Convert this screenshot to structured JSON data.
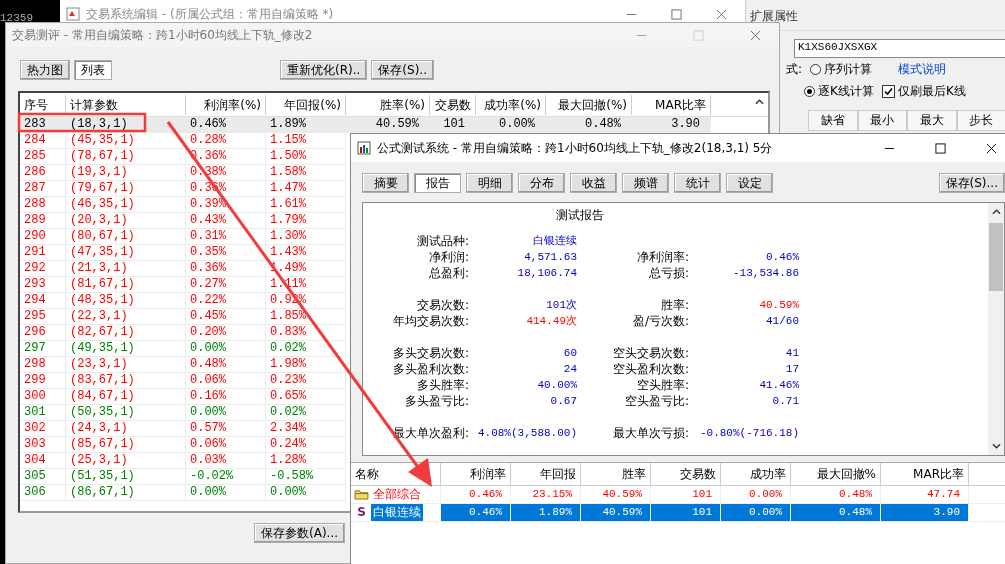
{
  "background": {
    "ticker": "12359"
  },
  "editor_window": {
    "title": "交易系统编辑 - (所属公式组：常用自编策略 *)"
  },
  "properties_panel": {
    "title": "扩展属性",
    "code_field": "K1XS60JXSXGX",
    "mode_label": "式:",
    "modes": [
      {
        "label": "序列计算",
        "selected": false
      },
      {
        "label": "逐K线计算",
        "selected": true
      }
    ],
    "help_link": "模式说明",
    "refresh_last_only": {
      "label": "仅刷最后K线",
      "checked": true
    },
    "param_columns": [
      "缺省",
      "最小",
      "最大",
      "步长"
    ]
  },
  "evaluation_window": {
    "title": "交易测评 - 常用自编策略：跨1小时60均线上下轨_修改2",
    "view_tabs": [
      {
        "label": "热力图",
        "selected": false
      },
      {
        "label": "列表",
        "selected": true
      }
    ],
    "buttons": [
      "重新优化(R)..",
      "保存(S).."
    ],
    "table": {
      "columns": [
        "序号",
        "计算参数",
        "利润率(%)",
        "年回报(%)",
        "胜率(%)",
        "交易数",
        "成功率(%)",
        "最大回撤(%)",
        "MAR比率"
      ],
      "rows": [
        {
          "cells": [
            "283",
            "(18,3,1)",
            "0.46%",
            "1.89%",
            "40.59%",
            "101",
            "0.00%",
            "0.48%",
            "3.90"
          ],
          "color": "#000000",
          "selected": true
        },
        {
          "cells": [
            "284",
            "(45,35,1)",
            "0.28%",
            "1.15%"
          ],
          "color": "#ff0000",
          "selected": false
        },
        {
          "cells": [
            "285",
            "(78,67,1)",
            "0.36%",
            "1.50%"
          ],
          "color": "#ff0000",
          "selected": false
        },
        {
          "cells": [
            "286",
            "(19,3,1)",
            "0.38%",
            "1.58%"
          ],
          "color": "#ff0000",
          "selected": false
        },
        {
          "cells": [
            "287",
            "(79,67,1)",
            "0.36%",
            "1.47%"
          ],
          "color": "#ff0000",
          "selected": false
        },
        {
          "cells": [
            "288",
            "(46,35,1)",
            "0.39%",
            "1.61%"
          ],
          "color": "#ff0000",
          "selected": false
        },
        {
          "cells": [
            "289",
            "(20,3,1)",
            "0.43%",
            "1.79%"
          ],
          "color": "#ff0000",
          "selected": false
        },
        {
          "cells": [
            "290",
            "(80,67,1)",
            "0.31%",
            "1.30%"
          ],
          "color": "#ff0000",
          "selected": false
        },
        {
          "cells": [
            "291",
            "(47,35,1)",
            "0.35%",
            "1.43%"
          ],
          "color": "#ff0000",
          "selected": false
        },
        {
          "cells": [
            "292",
            "(21,3,1)",
            "0.36%",
            "1.49%"
          ],
          "color": "#ff0000",
          "selected": false
        },
        {
          "cells": [
            "293",
            "(81,67,1)",
            "0.27%",
            "1.11%"
          ],
          "color": "#ff0000",
          "selected": false
        },
        {
          "cells": [
            "294",
            "(48,35,1)",
            "0.22%",
            "0.92%"
          ],
          "color": "#ff0000",
          "selected": false
        },
        {
          "cells": [
            "295",
            "(22,3,1)",
            "0.45%",
            "1.85%"
          ],
          "color": "#ff0000",
          "selected": false
        },
        {
          "cells": [
            "296",
            "(82,67,1)",
            "0.20%",
            "0.83%"
          ],
          "color": "#ff0000",
          "selected": false
        },
        {
          "cells": [
            "297",
            "(49,35,1)",
            "0.00%",
            "0.02%"
          ],
          "color": "#008000",
          "selected": false
        },
        {
          "cells": [
            "298",
            "(23,3,1)",
            "0.48%",
            "1.98%"
          ],
          "color": "#ff0000",
          "selected": false
        },
        {
          "cells": [
            "299",
            "(83,67,1)",
            "0.06%",
            "0.23%"
          ],
          "color": "#ff0000",
          "selected": false
        },
        {
          "cells": [
            "300",
            "(84,67,1)",
            "0.16%",
            "0.65%"
          ],
          "color": "#ff0000",
          "selected": false
        },
        {
          "cells": [
            "301",
            "(50,35,1)",
            "0.00%",
            "0.02%"
          ],
          "color": "#008000",
          "selected": false
        },
        {
          "cells": [
            "302",
            "(24,3,1)",
            "0.57%",
            "2.34%"
          ],
          "color": "#ff0000",
          "selected": false
        },
        {
          "cells": [
            "303",
            "(85,67,1)",
            "0.06%",
            "0.24%"
          ],
          "color": "#ff0000",
          "selected": false
        },
        {
          "cells": [
            "304",
            "(25,3,1)",
            "0.03%",
            "1.28%"
          ],
          "color": "#ff0000",
          "selected": false
        },
        {
          "cells": [
            "305",
            "(51,35,1)",
            "-0.02%",
            "-0.58%"
          ],
          "color": "#008000",
          "selected": false
        },
        {
          "cells": [
            "306",
            "(86,67,1)",
            "0.00%",
            "0.00%"
          ],
          "color": "#008000",
          "selected": false
        }
      ]
    },
    "save_params_button": "保存参数(A)..."
  },
  "test_window": {
    "title": "公式测试系统 - 常用自编策略：跨1小时60均线上下轨_修改2(18,3,1) 5分",
    "tabs": [
      {
        "label": "摘要",
        "selected": false
      },
      {
        "label": "报告",
        "selected": true
      },
      {
        "label": "明细",
        "selected": false
      },
      {
        "label": "分布",
        "selected": false
      },
      {
        "label": "收益",
        "selected": false
      },
      {
        "label": "频谱",
        "selected": false
      },
      {
        "label": "统计",
        "selected": false
      },
      {
        "label": "设定",
        "selected": false
      }
    ],
    "save_button": "保存(S)...",
    "report": {
      "title": "测试报告",
      "groups": [
        {
          "rows": [
            {
              "items": [
                {
                  "label": "测试品种:",
                  "value": "白银连续",
                  "alert": false
                }
              ]
            },
            {
              "items": [
                {
                  "label": "净利润:",
                  "value": "4,571.63",
                  "alert": false
                },
                {
                  "label": "净利润率:",
                  "value": "0.46%",
                  "alert": false
                }
              ]
            },
            {
              "items": [
                {
                  "label": "总盈利:",
                  "value": "18,106.74",
                  "alert": false
                },
                {
                  "label": "总亏损:",
                  "value": "-13,534.86",
                  "alert": false
                }
              ]
            }
          ]
        },
        {
          "rows": [
            {
              "items": [
                {
                  "label": "交易次数:",
                  "value": "101次",
                  "alert": false
                },
                {
                  "label": "胜率:",
                  "value": "40.59%",
                  "alert": true
                }
              ]
            },
            {
              "items": [
                {
                  "label": "年均交易次数:",
                  "value": "414.49次",
                  "alert": true
                },
                {
                  "label": "盈/亏次数:",
                  "value": "41/60",
                  "alert": false
                }
              ]
            }
          ]
        },
        {
          "rows": [
            {
              "items": [
                {
                  "label": "多头交易次数:",
                  "value": "60",
                  "alert": false
                },
                {
                  "label": "空头交易次数:",
                  "value": "41",
                  "alert": false
                }
              ]
            },
            {
              "items": [
                {
                  "label": "多头盈利次数:",
                  "value": "24",
                  "alert": false
                },
                {
                  "label": "空头盈利次数:",
                  "value": "17",
                  "alert": false
                }
              ]
            },
            {
              "items": [
                {
                  "label": "多头胜率:",
                  "value": "40.00%",
                  "alert": false
                },
                {
                  "label": "空头胜率:",
                  "value": "41.46%",
                  "alert": false
                }
              ]
            },
            {
              "items": [
                {
                  "label": "多头盈亏比:",
                  "value": "0.67",
                  "alert": false
                },
                {
                  "label": "空头盈亏比:",
                  "value": "0.71",
                  "alert": false
                }
              ]
            }
          ]
        },
        {
          "rows": [
            {
              "items": [
                {
                  "label": "最大单次盈利:",
                  "value": "4.08%(3,588.00)",
                  "alert": false
                },
                {
                  "label": "最大单次亏损:",
                  "value": "-0.80%(-716.18)",
                  "alert": false
                }
              ]
            }
          ]
        }
      ]
    },
    "summary_table": {
      "columns": [
        "名称",
        "利润率",
        "年回报",
        "胜率",
        "交易数",
        "成功率",
        "最大回撤%",
        "MAR比率"
      ],
      "rows": [
        {
          "kind": "group",
          "cells": [
            "全部综合",
            "0.46%",
            "23.15%",
            "40.59%",
            "101",
            "0.00%",
            "0.48%",
            "47.74"
          ],
          "selected": false
        },
        {
          "kind": "symbol",
          "marker": "S",
          "cells": [
            "白银连续",
            "0.46%",
            "1.89%",
            "40.59%",
            "101",
            "0.00%",
            "0.48%",
            "3.90"
          ],
          "selected": true
        }
      ]
    }
  }
}
